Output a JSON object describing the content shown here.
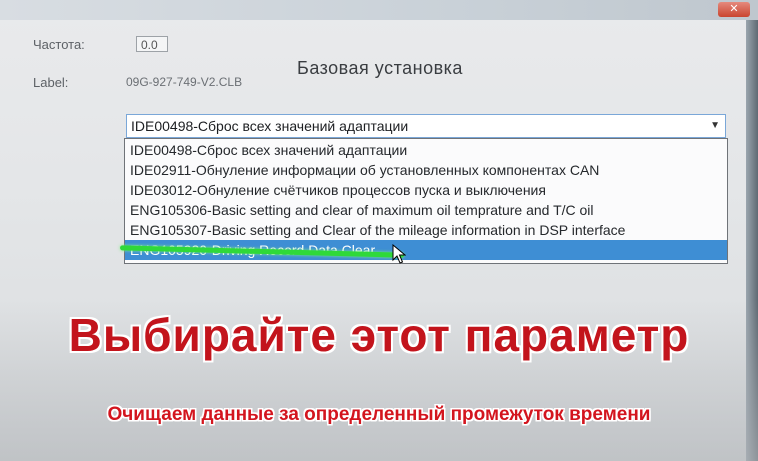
{
  "window": {
    "title": "",
    "close_glyph": "✕"
  },
  "form": {
    "frequency_label": "Частота:",
    "frequency_value": "0.0",
    "label_label": "Label:",
    "label_value": "09G-927-749-V2.CLB",
    "heading": "Базовая установка"
  },
  "combo": {
    "selected_value": "IDE00498-Сброс всех значений адаптации",
    "arrow_icon": "chevron-down-icon",
    "options": [
      "IDE00498-Сброс всех значений адаптации",
      "IDE02911-Обнуление информации об установленных компонентах CAN",
      "IDE03012-Обнуление счётчиков процессов пуска и выключения",
      "ENG105306-Basic setting and clear of maximum oil temprature and T/C oil",
      "ENG105307-Basic setting and Clear of the mileage information in DSP interface",
      "ENG105920-Driving Record Data Clear"
    ],
    "highlighted_index": 5
  },
  "overlay": {
    "title": "Выбирайте этот параметр",
    "subtitle": "Очищаем данные за определенный промежуток времени"
  },
  "colors": {
    "selection": "#3e8ed4",
    "overlay_text": "#c3141c",
    "marker": "#2fd93a"
  }
}
